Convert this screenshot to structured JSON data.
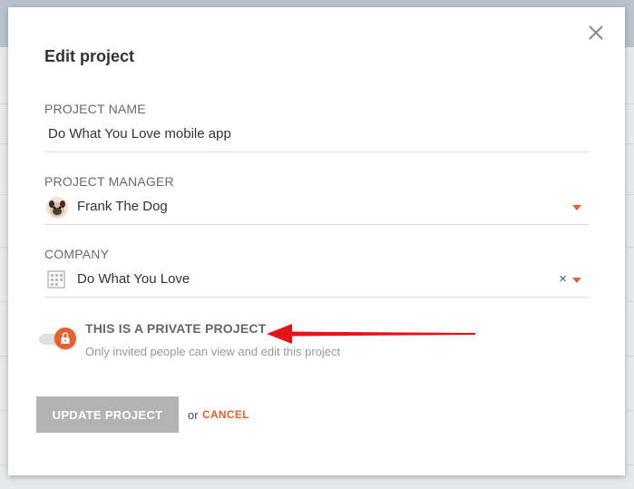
{
  "dialog": {
    "title": "Edit project",
    "close_icon": "close-icon"
  },
  "fields": {
    "project_name": {
      "label": "PROJECT NAME",
      "value": "Do What You Love mobile app"
    },
    "project_manager": {
      "label": "PROJECT MANAGER",
      "value": "Frank The Dog",
      "icon": "avatar"
    },
    "company": {
      "label": "COMPANY",
      "value": "Do What You Love",
      "icon": "building-icon",
      "clear": "×"
    }
  },
  "privacy": {
    "title": "THIS IS A PRIVATE PROJECT",
    "description": "Only invited people can view and edit this project",
    "enabled": true
  },
  "actions": {
    "update_label": "UPDATE PROJECT",
    "or_text": "or",
    "cancel_label": "CANCEL"
  },
  "colors": {
    "accent": "#e8602c",
    "annotation_arrow": "#e8131a",
    "button_disabled": "#b3b3b3"
  }
}
